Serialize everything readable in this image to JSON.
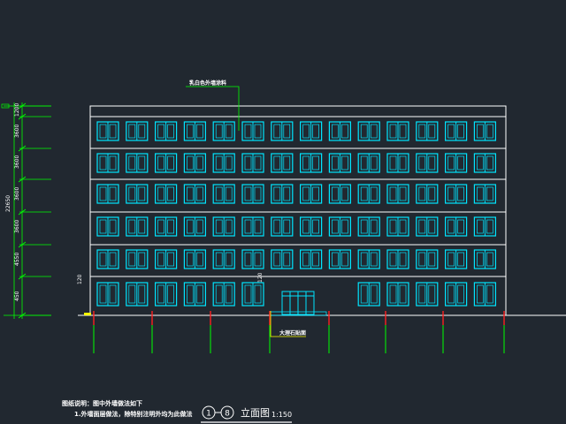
{
  "drawing": {
    "colors": {
      "background": "#212830",
      "outline": "#ffffff",
      "window": "#00e5ff",
      "dimension": "#00ff00",
      "axis": "#ff2020",
      "leader": "#ffff00"
    },
    "callouts": {
      "wall_finish": "乳白色外墙涂料",
      "base_finish": "大理石贴面"
    },
    "dimensions": {
      "total_height": "22650",
      "floor_heights": [
        "1200",
        "3600",
        "3600",
        "3600",
        "3600",
        "4550",
        "450"
      ],
      "elevation_marks": [
        "120",
        "120"
      ]
    },
    "notes": {
      "line1": "图纸说明：图中外墙做法如下",
      "line2": "1.外墙面层做法，除特别注明外均为此做法"
    },
    "title": {
      "axis_start": "1",
      "axis_end": "8",
      "name": "立面图",
      "scale": "1:150"
    },
    "icons": [
      "axis-bubble-icon"
    ]
  }
}
